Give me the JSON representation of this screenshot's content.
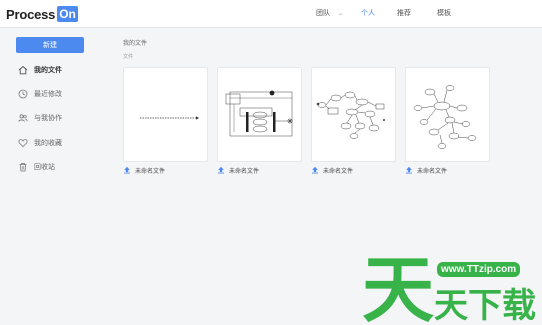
{
  "header": {
    "logo_text": "Process",
    "logo_badge": "On",
    "nav": {
      "team": "团队",
      "personal": "个人",
      "recommend": "推荐",
      "template": "模板"
    }
  },
  "sidebar": {
    "new_label": "新建",
    "items": [
      {
        "label": "我的文件",
        "icon": "home-icon",
        "active": true
      },
      {
        "label": "最近修改",
        "icon": "clock-icon",
        "active": false
      },
      {
        "label": "与我协作",
        "icon": "users-icon",
        "active": false
      },
      {
        "label": "我的收藏",
        "icon": "heart-icon",
        "active": false
      },
      {
        "label": "回收站",
        "icon": "trash-icon",
        "active": false
      }
    ]
  },
  "main": {
    "breadcrumb": "我的文件",
    "section_label": "文件",
    "files": [
      {
        "name": "未命名文件",
        "thumb": "arrow-diagram"
      },
      {
        "name": "未命名文件",
        "thumb": "uml-diagram"
      },
      {
        "name": "未命名文件",
        "thumb": "flow-diagram"
      },
      {
        "name": "未命名文件",
        "thumb": "mindmap-diagram"
      }
    ]
  },
  "watermark": {
    "url": "www.TTzip.com",
    "text": "天天下载"
  },
  "colors": {
    "accent": "#4d8af0",
    "watermark_green": "#37b34a"
  }
}
